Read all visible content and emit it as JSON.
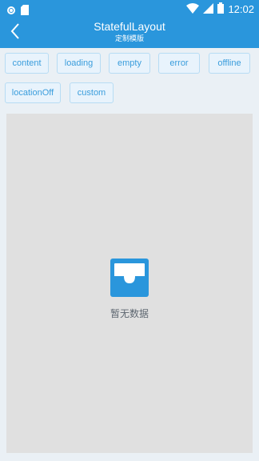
{
  "status_bar": {
    "time": "12:02",
    "icons": [
      "circle-icon",
      "sim-card-icon",
      "wifi-icon",
      "signal-icon",
      "battery-icon"
    ]
  },
  "app_bar": {
    "title": "StatefulLayout",
    "subtitle": "定制模版",
    "back_icon": "chevron-left-icon"
  },
  "buttons": {
    "content": "content",
    "loading": "loading",
    "empty": "empty",
    "error": "error",
    "offline": "offline",
    "locationOff": "locationOff",
    "custom": "custom"
  },
  "empty_state": {
    "icon": "inbox-icon",
    "text": "暂无数据"
  },
  "colors": {
    "primary": "#2a96dc",
    "chip_border": "#b7dcf4",
    "chip_text": "#3a9ddc",
    "panel_bg": "#e0e0e0"
  }
}
